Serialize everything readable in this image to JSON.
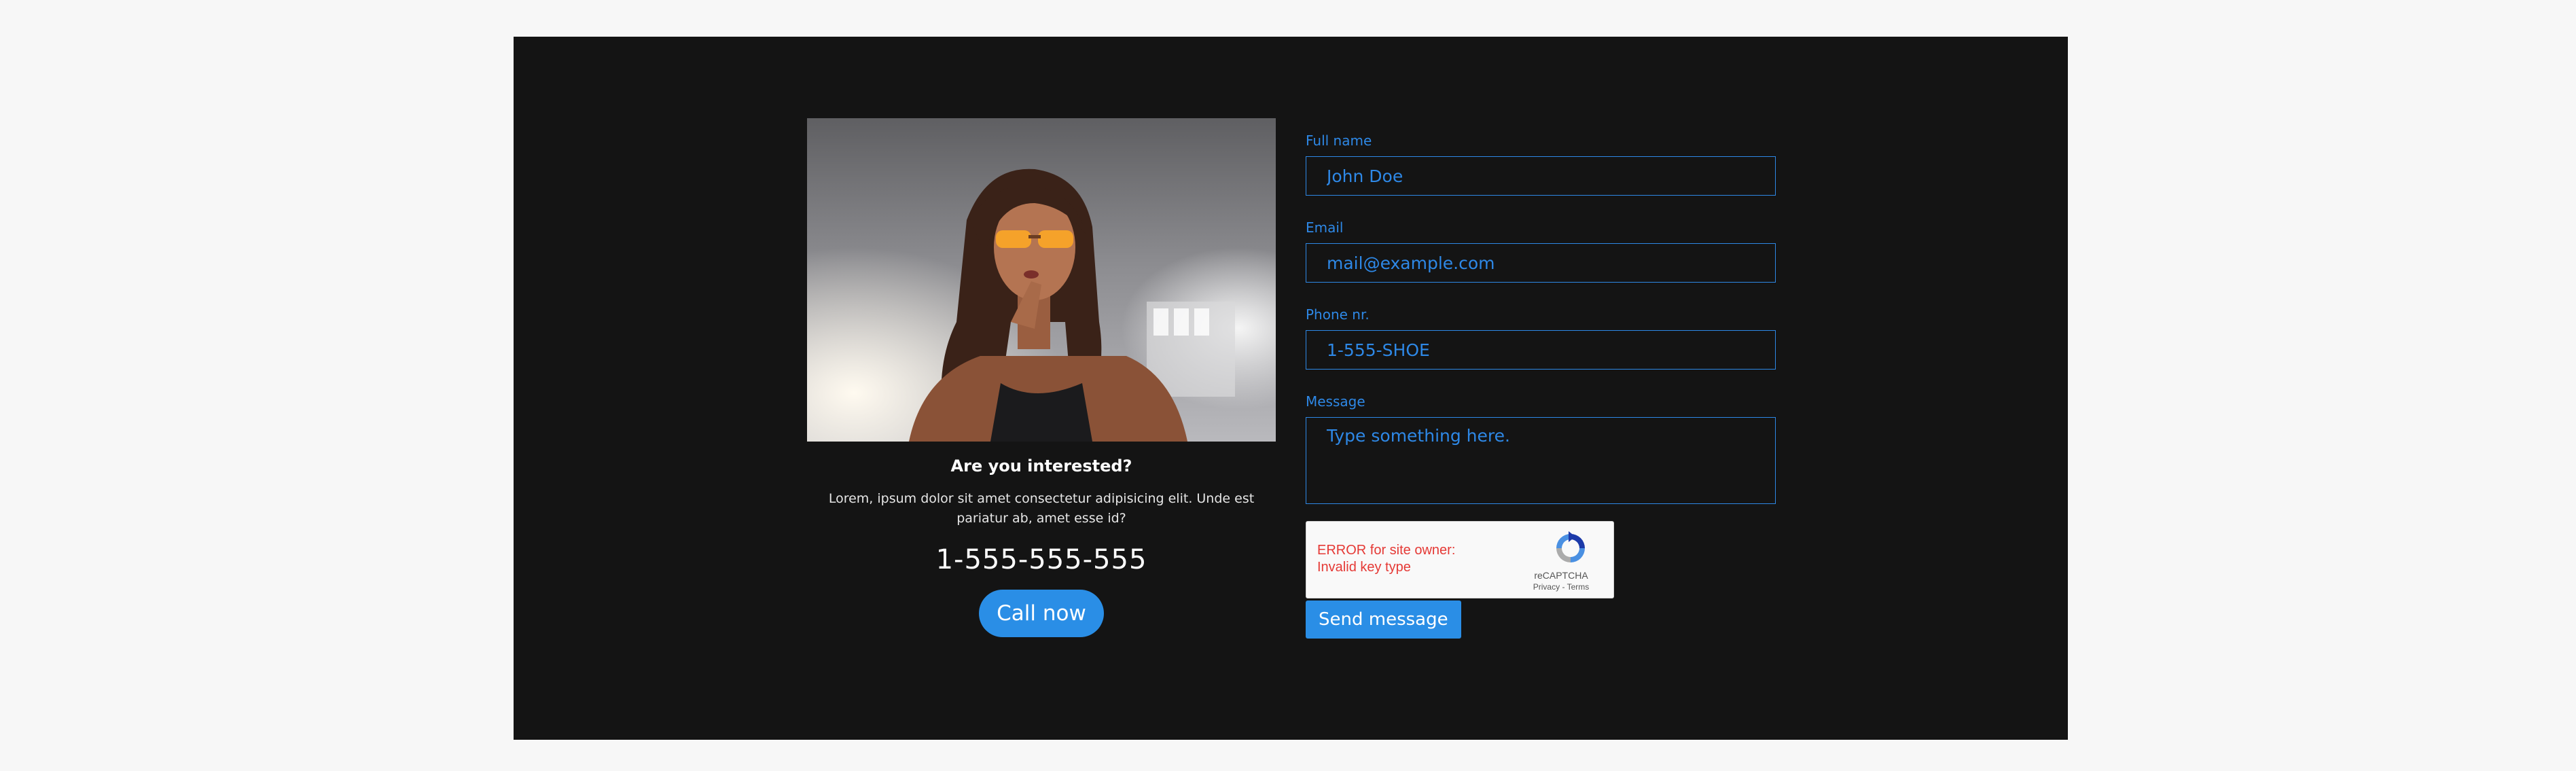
{
  "promo": {
    "image_alt": "Woman wearing orange sunglasses",
    "heading": "Are you interested?",
    "text": "Lorem, ipsum dolor sit amet consectetur adipisicing elit. Unde est pariatur ab, amet esse id?",
    "phone": "1-555-555-555",
    "call_label": "Call now"
  },
  "form": {
    "full_name": {
      "label": "Full name",
      "placeholder": "John Doe"
    },
    "email": {
      "label": "Email",
      "placeholder": "mail@example.com"
    },
    "phone": {
      "label": "Phone nr.",
      "placeholder": "1-555-SHOE"
    },
    "message": {
      "label": "Message",
      "placeholder": "Type something here."
    },
    "submit_label": "Send message"
  },
  "recaptcha": {
    "error": "ERROR for site owner: Invalid key type",
    "brand": "reCAPTCHA",
    "privacy": "Privacy",
    "separator": " - ",
    "terms": "Terms"
  },
  "colors": {
    "page_background": "#f7f7f7",
    "panel_background": "#141414",
    "accent": "#2e88e6",
    "button": "#2a8ee6",
    "error": "#e53935"
  },
  "icons": {
    "recaptcha": "recaptcha-logo-icon"
  }
}
